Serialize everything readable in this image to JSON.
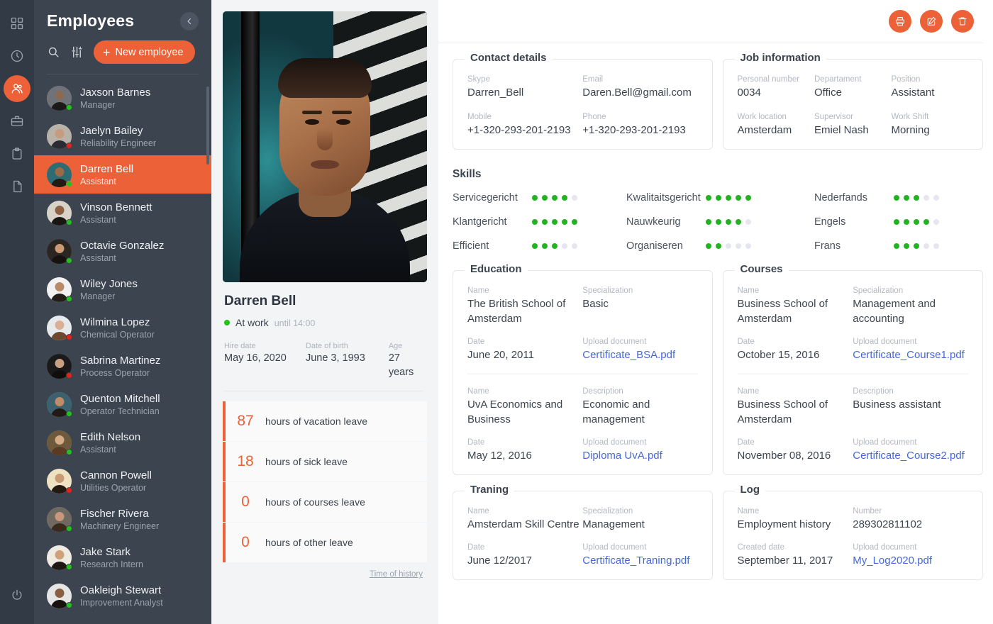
{
  "rail": {
    "items": [
      {
        "icon": "dashboard-grid-icon",
        "active": false
      },
      {
        "icon": "clock-icon",
        "active": false
      },
      {
        "icon": "people-icon",
        "active": true
      },
      {
        "icon": "briefcase-icon",
        "active": false
      },
      {
        "icon": "clipboard-icon",
        "active": false
      },
      {
        "icon": "document-icon",
        "active": false
      }
    ],
    "power_icon": "power-icon"
  },
  "sidebar": {
    "title": "Employees",
    "collapse_icon": "chevron-left-icon",
    "search_icon": "search-icon",
    "filter_icon": "filter-sliders-icon",
    "new_button": "New employee",
    "new_button_plus": "+",
    "employees": [
      {
        "name": "Jaxson Barnes",
        "role": "Manager",
        "status": "online",
        "selected": false,
        "skin": "#8a6a52",
        "hair": "#1c1a18",
        "bg": "#6f7278"
      },
      {
        "name": "Jaelyn Bailey",
        "role": "Reliability Engineer",
        "status": "offline",
        "selected": false,
        "skin": "#c79b7d",
        "hair": "#2b2b33",
        "bg": "#b9b2a8"
      },
      {
        "name": "Darren Bell",
        "role": "Assistant",
        "status": "online",
        "selected": true,
        "skin": "#9a6a46",
        "hair": "#241a14",
        "bg": "#2f6b72"
      },
      {
        "name": "Vinson Bennett",
        "role": "Assistant",
        "status": "online",
        "selected": false,
        "skin": "#8d6144",
        "hair": "#191613",
        "bg": "#d8d2c9"
      },
      {
        "name": "Octavie Gonzalez",
        "role": "Assistant",
        "status": "online",
        "selected": false,
        "skin": "#c99a74",
        "hair": "#17120f",
        "bg": "#2b2622"
      },
      {
        "name": "Wiley Jones",
        "role": "Manager",
        "status": "online",
        "selected": false,
        "skin": "#b98a68",
        "hair": "#231c17",
        "bg": "#f2f2f2"
      },
      {
        "name": "Wilmina Lopez",
        "role": "Chemical Operator",
        "status": "offline",
        "selected": false,
        "skin": "#d9b094",
        "hair": "#6d4a2f",
        "bg": "#e7eaec"
      },
      {
        "name": "Sabrina Martinez",
        "role": "Process Operator",
        "status": "offline",
        "selected": false,
        "skin": "#c8a184",
        "hair": "#100e0c",
        "bg": "#1a1a1a"
      },
      {
        "name": "Quenton Mitchell",
        "role": "Operator Technician",
        "status": "online",
        "selected": false,
        "skin": "#c08c68",
        "hair": "#221a14",
        "bg": "#3c6270"
      },
      {
        "name": "Edith Nelson",
        "role": "Assistant",
        "status": "online",
        "selected": false,
        "skin": "#d8ab88",
        "hair": "#5a3a21",
        "bg": "#6d5a3c"
      },
      {
        "name": "Cannon Powell",
        "role": "Utilities Operator",
        "status": "offline",
        "selected": false,
        "skin": "#c99a74",
        "hair": "#241a12",
        "bg": "#efe2c3"
      },
      {
        "name": "Fischer Rivera",
        "role": "Machinery Engineer",
        "status": "online",
        "selected": false,
        "skin": "#c8987a",
        "hair": "#3b2a1c",
        "bg": "#6e6a62"
      },
      {
        "name": "Jake Stark",
        "role": "Research Intern",
        "status": "online",
        "selected": false,
        "skin": "#cfa07c",
        "hair": "#1f1814",
        "bg": "#efeae2"
      },
      {
        "name": "Oakleigh Stewart",
        "role": "Improvement Analyst",
        "status": "online",
        "selected": false,
        "skin": "#8a5f41",
        "hair": "#17120e",
        "bg": "#e6e6e6"
      }
    ]
  },
  "profile": {
    "photo_alt": "employee-portrait",
    "name": "Darren Bell",
    "status_text": "At work",
    "status_until": "until 14:00",
    "status_color": "#22c11b",
    "facts": [
      {
        "label": "Hire date",
        "value": "May 16, 2020"
      },
      {
        "label": "Date of birth",
        "value": "June 3, 1993"
      },
      {
        "label": "Age",
        "value": "27 years"
      }
    ],
    "leave": [
      {
        "number": "87",
        "label": "hours of vacation leave"
      },
      {
        "number": "18",
        "label": "hours of sick leave"
      },
      {
        "number": "0",
        "label": "hours of courses leave"
      },
      {
        "number": "0",
        "label": "hours of other leave"
      }
    ],
    "time_of_history": "Time of history"
  },
  "topbar": {
    "print_icon": "print-icon",
    "edit_icon": "edit-pencil-icon",
    "delete_icon": "trash-icon",
    "accent": "#ec6137"
  },
  "contact_details": {
    "legend": "Contact details",
    "fields": [
      {
        "label": "Skype",
        "value": "Darren_Bell"
      },
      {
        "label": "Email",
        "value": "Daren.Bell@gmail.com"
      },
      {
        "label": "Mobile",
        "value": "+1-320-293-201-2193"
      },
      {
        "label": "Phone",
        "value": "+1-320-293-201-2193"
      }
    ]
  },
  "job_information": {
    "legend": "Job information",
    "fields": [
      {
        "label": "Personal number",
        "value": "0034"
      },
      {
        "label": "Departament",
        "value": "Office"
      },
      {
        "label": "Position",
        "value": "Assistant"
      },
      {
        "label": "Work location",
        "value": "Amsterdam"
      },
      {
        "label": "Supervisor",
        "value": "Emiel Nash"
      },
      {
        "label": "Work Shift",
        "value": "Morning"
      }
    ]
  },
  "skills": {
    "title": "Skills",
    "max": 5,
    "active_color": "#22b322",
    "inactive_color": "#e6e6f0",
    "items": [
      {
        "name": "Servicegericht",
        "value": 4
      },
      {
        "name": "Kwalitaitsgericht",
        "value": 5
      },
      {
        "name": "Nederfands",
        "value": 3
      },
      {
        "name": "Klantgericht",
        "value": 5
      },
      {
        "name": "Nauwkeurig",
        "value": 4
      },
      {
        "name": "Engels",
        "value": 4
      },
      {
        "name": "Efficient",
        "value": 3
      },
      {
        "name": "Organiseren",
        "value": 2
      },
      {
        "name": "Frans",
        "value": 3
      }
    ]
  },
  "education": {
    "legend": "Education",
    "entries": [
      {
        "f1_label": "Name",
        "f1_value": "The British School of Amsterdam",
        "f2_label": "Specialization",
        "f2_value": "Basic",
        "f3_label": "Date",
        "f3_value": "June 20, 2011",
        "f4_label": "Upload document",
        "f4_value": "Certificate_BSA.pdf"
      },
      {
        "f1_label": "Name",
        "f1_value": "UvA Economics and Business",
        "f2_label": "Description",
        "f2_value": "Economic and management",
        "f3_label": "Date",
        "f3_value": "May 12, 2016",
        "f4_label": "Upload document",
        "f4_value": "Diploma UvA.pdf"
      }
    ]
  },
  "courses": {
    "legend": "Courses",
    "entries": [
      {
        "f1_label": "Name",
        "f1_value": "Business School of Amsterdam",
        "f2_label": "Specialization",
        "f2_value": "Management and accounting",
        "f3_label": "Date",
        "f3_value": "October 15, 2016",
        "f4_label": "Upload document",
        "f4_value": "Certificate_Course1.pdf"
      },
      {
        "f1_label": "Name",
        "f1_value": "Business School of Amsterdam",
        "f2_label": "Description",
        "f2_value": "Business assistant",
        "f3_label": "Date",
        "f3_value": "November 08, 2016",
        "f4_label": "Upload document",
        "f4_value": "Certificate_Course2.pdf"
      }
    ]
  },
  "training": {
    "legend": "Traning",
    "entries": [
      {
        "f1_label": "Name",
        "f1_value": "Amsterdam Skill Centre",
        "f2_label": "Specialization",
        "f2_value": "Management",
        "f3_label": "Date",
        "f3_value": "June 12/2017",
        "f4_label": "Upload document",
        "f4_value": "Certificate_Traning.pdf"
      }
    ]
  },
  "log": {
    "legend": "Log",
    "entries": [
      {
        "f1_label": "Name",
        "f1_value": "Employment history",
        "f2_label": "Number",
        "f2_value": "289302811102",
        "f3_label": "Created date",
        "f3_value": "September 11, 2017",
        "f4_label": "Upload document",
        "f4_value": "My_Log2020.pdf"
      }
    ]
  }
}
